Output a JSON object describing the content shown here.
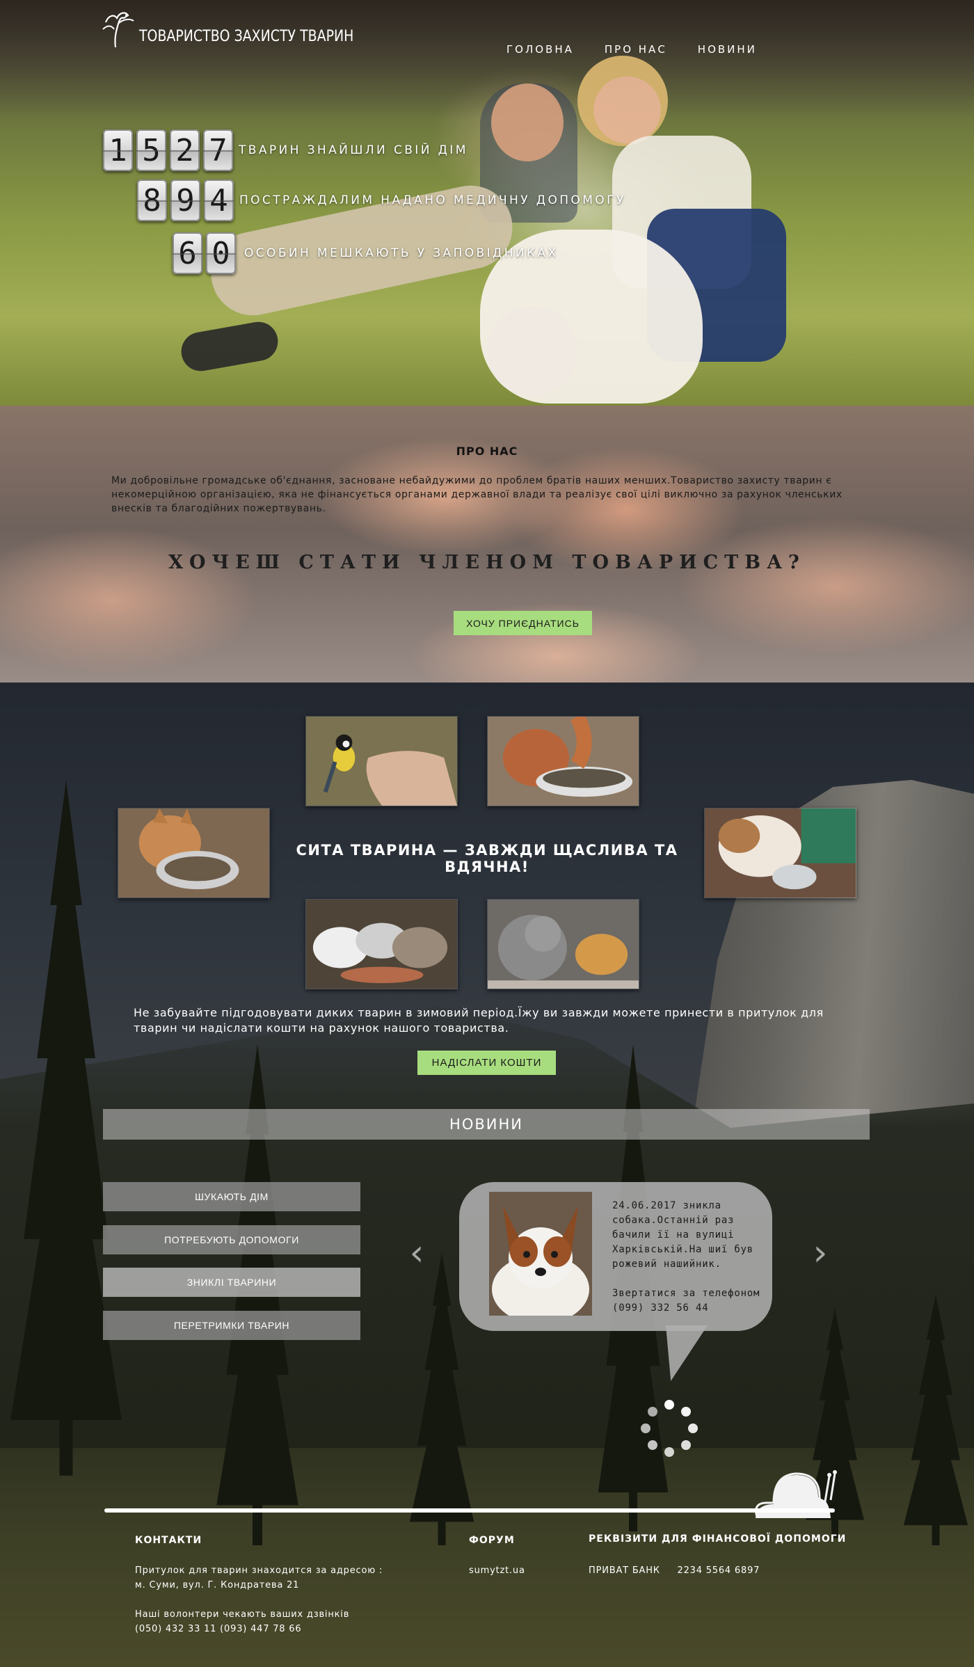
{
  "header": {
    "logo_text": "ТОВАРИСТВО ЗАХИСТУ ТВАРИН",
    "nav": [
      {
        "label": "ГОЛОВНА"
      },
      {
        "label": "ПРО НАС"
      },
      {
        "label": "НОВИНИ"
      }
    ]
  },
  "counters": [
    {
      "digits": [
        "1",
        "5",
        "2",
        "7"
      ],
      "label": "ТВАРИН ЗНАЙШЛИ СВІЙ ДІМ"
    },
    {
      "digits": [
        "8",
        "9",
        "4"
      ],
      "label": "ПОСТРАЖДАЛИМ НАДАНО МЕДИЧНУ ДОПОМОГУ"
    },
    {
      "digits": [
        "6",
        "0"
      ],
      "label": "ОСОБИН МЕШКАЮТЬ У ЗАПОВІДНИКАХ"
    }
  ],
  "about": {
    "title": "ПРО НАС",
    "text": "Ми добровільне громадське об'єднання, засноване небайдужими до проблем братів наших менших.Товариство захисту тварин є некомерційною організацією, яка не фінансується органами державної влади та реалізує свої цілі виключно за рахунок членських внесків та благодійних пожертвувань.",
    "join_title": "ХОЧЕШ СТАТИ ЧЛЕНОМ ТОВАРИСТВА?",
    "join_button": "ХОЧУ ПРИЄДНАТИСЬ"
  },
  "feeding": {
    "title": "СИТА ТВАРИНА — ЗАВЖДИ ЩАСЛИВА ТА ВДЯЧНА!",
    "text": "Не забувайте підгодовувати диких тварин в зимовий період.Їжу ви завжди можете принести в притулок для тварин чи надіслати кошти на рахунок нашого товариства.",
    "button": "НАДІСЛАТИ КОШТИ"
  },
  "news": {
    "title": "НОВИНИ",
    "categories": [
      {
        "label": "ШУКАЮТЬ ДІМ"
      },
      {
        "label": "ПОТРЕБУЮТЬ ДОПОМОГИ"
      },
      {
        "label": "ЗНИКЛІ ТВАРИНИ"
      },
      {
        "label": "ПЕРЕТРИМКИ ТВАРИН"
      }
    ],
    "item_text": "24.06.2017 зникла собака.Останній раз бачили її на вулиці Харківській.На шиї був рожевий нашийник.\n\nЗвертатися за телефоном (099) 332 56 44",
    "prev": "‹",
    "next": "›"
  },
  "footer": {
    "contacts_title": "КОНТАКТИ",
    "contacts_text": "Притулок для тварин знаходится за адресою :\nм. Суми, вул. Г. Кондратева 21\n\nНаші волонтери чекають ваших дзвінків\n(050) 432 33 11     (093) 447 78 66",
    "forum_title": "ФОРУМ",
    "forum_link": "sumytzt.ua",
    "bank_title": "РЕКВІЗИТИ ДЛЯ ФІНАНСОВОЇ ДОПОМОГИ",
    "bank_text": "ПРИВАТ БАНК     2234 5564 6897"
  },
  "colors": {
    "accent_button": "#a8dd7f",
    "news_bar": "#c8c8c8",
    "bubble": "#afafaf"
  },
  "icons": [
    "birds-logo-icon",
    "chevron-left-icon",
    "chevron-right-icon",
    "loading-spinner-icon",
    "snail-icon"
  ]
}
